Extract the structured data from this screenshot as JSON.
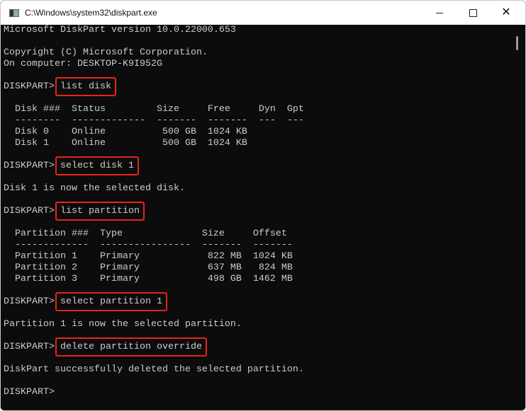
{
  "window": {
    "title": "C:\\Windows\\system32\\diskpart.exe",
    "minimize": "minimize-icon",
    "maximize": "maximize-icon",
    "close": "close-icon"
  },
  "colors": {
    "background": "#0c0c0c",
    "text": "#cccccc",
    "highlight": "#e8231b"
  },
  "lines": [
    {
      "text": "Microsoft DiskPart version 10.0.22000.653"
    },
    {
      "text": ""
    },
    {
      "text": "Copyright (C) Microsoft Corporation."
    },
    {
      "text": "On computer: DESKTOP-K9I952G"
    },
    {
      "text": ""
    },
    {
      "prompt": "DISKPART> ",
      "cmd": "list disk"
    },
    {
      "text": ""
    },
    {
      "text": "  Disk ###  Status         Size     Free     Dyn  Gpt"
    },
    {
      "text": "  --------  -------------  -------  -------  ---  ---"
    },
    {
      "text": "  Disk 0    Online          500 GB  1024 KB"
    },
    {
      "text": "  Disk 1    Online          500 GB  1024 KB"
    },
    {
      "text": ""
    },
    {
      "prompt": "DISKPART> ",
      "cmd": "select disk 1"
    },
    {
      "text": ""
    },
    {
      "text": "Disk 1 is now the selected disk."
    },
    {
      "text": ""
    },
    {
      "prompt": "DISKPART> ",
      "cmd": "list partition"
    },
    {
      "text": ""
    },
    {
      "text": "  Partition ###  Type              Size     Offset"
    },
    {
      "text": "  -------------  ----------------  -------  -------"
    },
    {
      "text": "  Partition 1    Primary            822 MB  1024 KB"
    },
    {
      "text": "  Partition 2    Primary            637 MB   824 MB"
    },
    {
      "text": "  Partition 3    Primary            498 GB  1462 MB"
    },
    {
      "text": ""
    },
    {
      "prompt": "DISKPART> ",
      "cmd": "select partition 1"
    },
    {
      "text": ""
    },
    {
      "text": "Partition 1 is now the selected partition."
    },
    {
      "text": ""
    },
    {
      "prompt": "DISKPART> ",
      "cmd": "delete partition override"
    },
    {
      "text": ""
    },
    {
      "text": "DiskPart successfully deleted the selected partition."
    },
    {
      "text": ""
    },
    {
      "prompt": "DISKPART> ",
      "cmd": ""
    }
  ]
}
